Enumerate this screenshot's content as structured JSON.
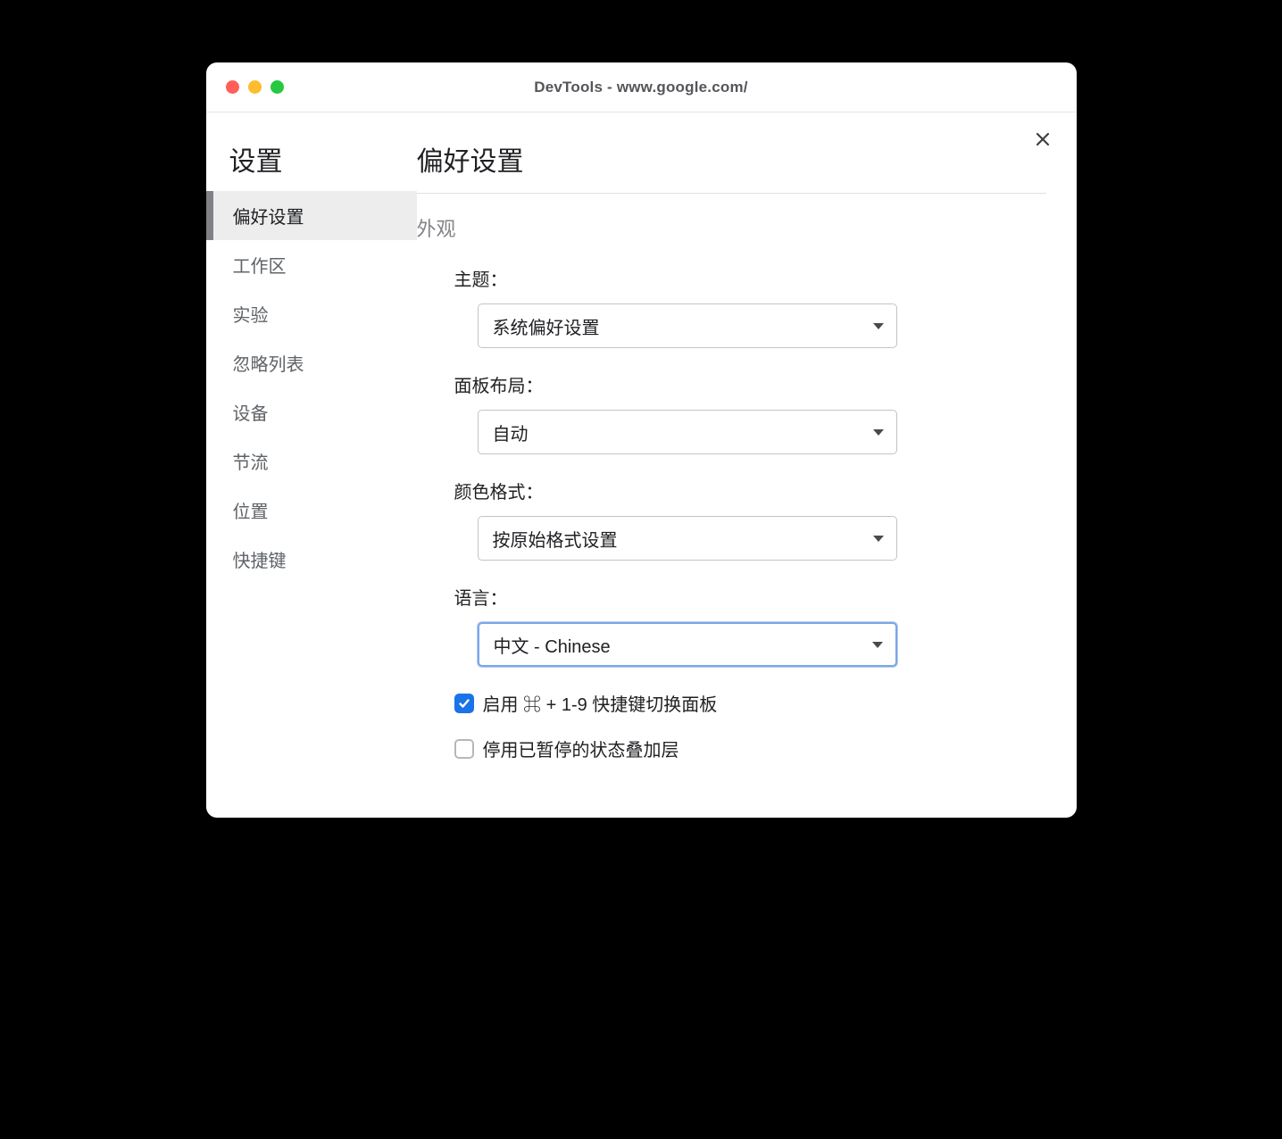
{
  "window": {
    "title": "DevTools - www.google.com/"
  },
  "sidebar": {
    "title": "设置",
    "items": [
      {
        "label": "偏好设置",
        "active": true
      },
      {
        "label": "工作区",
        "active": false
      },
      {
        "label": "实验",
        "active": false
      },
      {
        "label": "忽略列表",
        "active": false
      },
      {
        "label": "设备",
        "active": false
      },
      {
        "label": "节流",
        "active": false
      },
      {
        "label": "位置",
        "active": false
      },
      {
        "label": "快捷键",
        "active": false
      }
    ]
  },
  "page": {
    "title": "偏好设置",
    "section_appearance": "外观",
    "theme": {
      "label": "主题：",
      "value": "系统偏好设置"
    },
    "panel_layout": {
      "label": "面板布局：",
      "value": "自动"
    },
    "color_format": {
      "label": "颜色格式：",
      "value": "按原始格式设置"
    },
    "language": {
      "label": "语言：",
      "value": "中文 - Chinese"
    },
    "checkbox_shortcut": {
      "label": "启用 ⌘ + 1-9 快捷键切换面板",
      "checked": true
    },
    "checkbox_overlay": {
      "label": "停用已暂停的状态叠加层",
      "checked": false
    }
  }
}
